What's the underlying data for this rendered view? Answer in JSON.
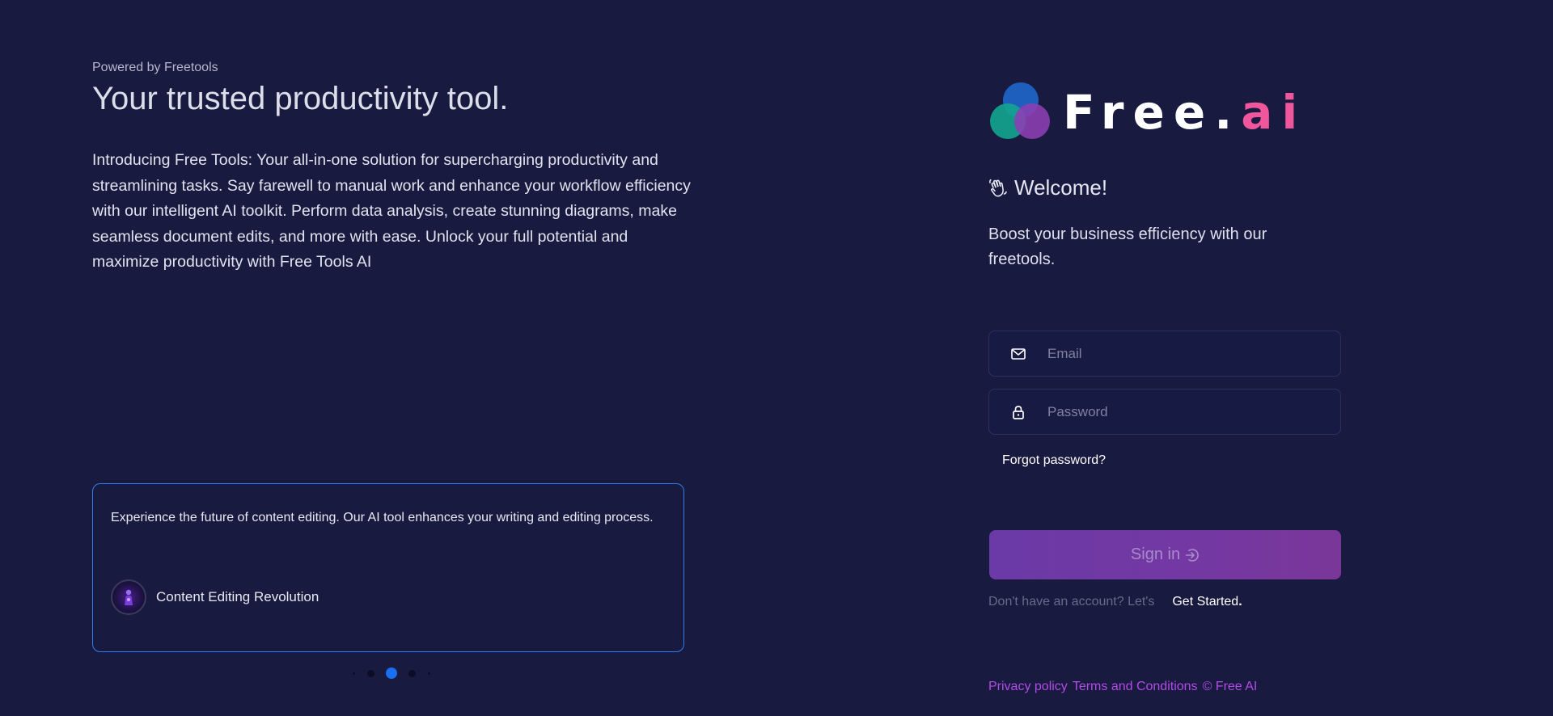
{
  "left": {
    "powered_by": "Powered by Freetools",
    "headline": "Your trusted productivity tool.",
    "intro": "Introducing Free Tools: Your all-in-one solution for supercharging productivity and streamlining tasks. Say farewell to manual work and enhance your workflow efficiency with our intelligent AI toolkit. Perform data analysis, create stunning diagrams, make seamless document edits, and more with ease. Unlock your full potential and maximize productivity with Free Tools AI"
  },
  "carousel": {
    "text": "Experience the future of content editing. Our AI tool enhances your writing and editing process.",
    "title": "Content Editing Revolution",
    "active_index": 2,
    "dot_count": 5
  },
  "brand": {
    "word_main": "Free.",
    "word_accent": "ai",
    "accent_color": "#f0569c"
  },
  "login": {
    "welcome": "Welcome!",
    "tagline": "Boost your business efficiency with our freetools.",
    "email_placeholder": "Email",
    "password_placeholder": "Password",
    "forgot": "Forgot password?",
    "signin": "Sign in",
    "no_account": "Don't have an account? Let's",
    "get_started": "Get Started",
    "get_started_suffix": "."
  },
  "footer": {
    "privacy": "Privacy policy",
    "terms": "Terms and Conditions",
    "copyright": "© Free AI"
  },
  "colors": {
    "background": "#181a40",
    "carousel_border": "#2f7ef0",
    "signin_button": "#7438a3",
    "footer_link": "#b34be6"
  }
}
